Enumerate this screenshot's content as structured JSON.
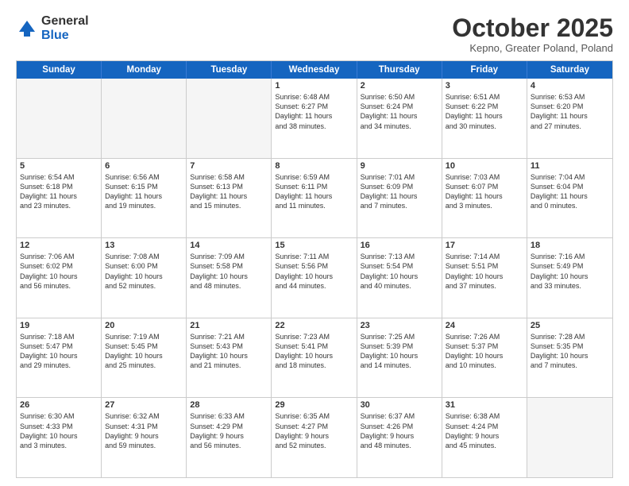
{
  "logo": {
    "general": "General",
    "blue": "Blue"
  },
  "title": "October 2025",
  "subtitle": "Kepno, Greater Poland, Poland",
  "days_of_week": [
    "Sunday",
    "Monday",
    "Tuesday",
    "Wednesday",
    "Thursday",
    "Friday",
    "Saturday"
  ],
  "rows": [
    [
      {
        "day": "",
        "text": ""
      },
      {
        "day": "",
        "text": ""
      },
      {
        "day": "",
        "text": ""
      },
      {
        "day": "1",
        "text": "Sunrise: 6:48 AM\nSunset: 6:27 PM\nDaylight: 11 hours\nand 38 minutes."
      },
      {
        "day": "2",
        "text": "Sunrise: 6:50 AM\nSunset: 6:24 PM\nDaylight: 11 hours\nand 34 minutes."
      },
      {
        "day": "3",
        "text": "Sunrise: 6:51 AM\nSunset: 6:22 PM\nDaylight: 11 hours\nand 30 minutes."
      },
      {
        "day": "4",
        "text": "Sunrise: 6:53 AM\nSunset: 6:20 PM\nDaylight: 11 hours\nand 27 minutes."
      }
    ],
    [
      {
        "day": "5",
        "text": "Sunrise: 6:54 AM\nSunset: 6:18 PM\nDaylight: 11 hours\nand 23 minutes."
      },
      {
        "day": "6",
        "text": "Sunrise: 6:56 AM\nSunset: 6:15 PM\nDaylight: 11 hours\nand 19 minutes."
      },
      {
        "day": "7",
        "text": "Sunrise: 6:58 AM\nSunset: 6:13 PM\nDaylight: 11 hours\nand 15 minutes."
      },
      {
        "day": "8",
        "text": "Sunrise: 6:59 AM\nSunset: 6:11 PM\nDaylight: 11 hours\nand 11 minutes."
      },
      {
        "day": "9",
        "text": "Sunrise: 7:01 AM\nSunset: 6:09 PM\nDaylight: 11 hours\nand 7 minutes."
      },
      {
        "day": "10",
        "text": "Sunrise: 7:03 AM\nSunset: 6:07 PM\nDaylight: 11 hours\nand 3 minutes."
      },
      {
        "day": "11",
        "text": "Sunrise: 7:04 AM\nSunset: 6:04 PM\nDaylight: 11 hours\nand 0 minutes."
      }
    ],
    [
      {
        "day": "12",
        "text": "Sunrise: 7:06 AM\nSunset: 6:02 PM\nDaylight: 10 hours\nand 56 minutes."
      },
      {
        "day": "13",
        "text": "Sunrise: 7:08 AM\nSunset: 6:00 PM\nDaylight: 10 hours\nand 52 minutes."
      },
      {
        "day": "14",
        "text": "Sunrise: 7:09 AM\nSunset: 5:58 PM\nDaylight: 10 hours\nand 48 minutes."
      },
      {
        "day": "15",
        "text": "Sunrise: 7:11 AM\nSunset: 5:56 PM\nDaylight: 10 hours\nand 44 minutes."
      },
      {
        "day": "16",
        "text": "Sunrise: 7:13 AM\nSunset: 5:54 PM\nDaylight: 10 hours\nand 40 minutes."
      },
      {
        "day": "17",
        "text": "Sunrise: 7:14 AM\nSunset: 5:51 PM\nDaylight: 10 hours\nand 37 minutes."
      },
      {
        "day": "18",
        "text": "Sunrise: 7:16 AM\nSunset: 5:49 PM\nDaylight: 10 hours\nand 33 minutes."
      }
    ],
    [
      {
        "day": "19",
        "text": "Sunrise: 7:18 AM\nSunset: 5:47 PM\nDaylight: 10 hours\nand 29 minutes."
      },
      {
        "day": "20",
        "text": "Sunrise: 7:19 AM\nSunset: 5:45 PM\nDaylight: 10 hours\nand 25 minutes."
      },
      {
        "day": "21",
        "text": "Sunrise: 7:21 AM\nSunset: 5:43 PM\nDaylight: 10 hours\nand 21 minutes."
      },
      {
        "day": "22",
        "text": "Sunrise: 7:23 AM\nSunset: 5:41 PM\nDaylight: 10 hours\nand 18 minutes."
      },
      {
        "day": "23",
        "text": "Sunrise: 7:25 AM\nSunset: 5:39 PM\nDaylight: 10 hours\nand 14 minutes."
      },
      {
        "day": "24",
        "text": "Sunrise: 7:26 AM\nSunset: 5:37 PM\nDaylight: 10 hours\nand 10 minutes."
      },
      {
        "day": "25",
        "text": "Sunrise: 7:28 AM\nSunset: 5:35 PM\nDaylight: 10 hours\nand 7 minutes."
      }
    ],
    [
      {
        "day": "26",
        "text": "Sunrise: 6:30 AM\nSunset: 4:33 PM\nDaylight: 10 hours\nand 3 minutes."
      },
      {
        "day": "27",
        "text": "Sunrise: 6:32 AM\nSunset: 4:31 PM\nDaylight: 9 hours\nand 59 minutes."
      },
      {
        "day": "28",
        "text": "Sunrise: 6:33 AM\nSunset: 4:29 PM\nDaylight: 9 hours\nand 56 minutes."
      },
      {
        "day": "29",
        "text": "Sunrise: 6:35 AM\nSunset: 4:27 PM\nDaylight: 9 hours\nand 52 minutes."
      },
      {
        "day": "30",
        "text": "Sunrise: 6:37 AM\nSunset: 4:26 PM\nDaylight: 9 hours\nand 48 minutes."
      },
      {
        "day": "31",
        "text": "Sunrise: 6:38 AM\nSunset: 4:24 PM\nDaylight: 9 hours\nand 45 minutes."
      },
      {
        "day": "",
        "text": ""
      }
    ]
  ]
}
